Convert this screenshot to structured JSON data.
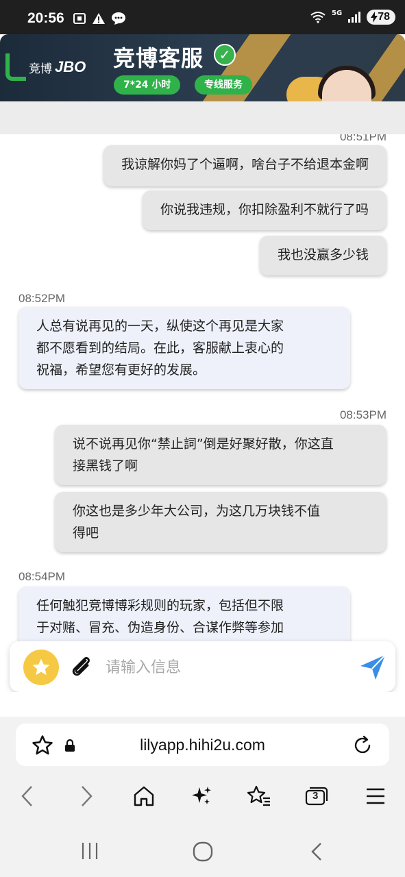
{
  "status_bar": {
    "time": "20:56",
    "battery": "78",
    "network": "5G"
  },
  "banner": {
    "logo_cn": "竞博",
    "logo_en": "JBO",
    "title": "竞博客服",
    "pill_hours": "7*24 小时",
    "pill_service": "专线服务",
    "accent_color": "#2fb24a"
  },
  "chat": {
    "partial_timestamp": "08:51PM",
    "messages": [
      {
        "side": "out",
        "text": "我谅解你妈了个逼啊，啥台子不给退本金啊"
      },
      {
        "side": "out",
        "text": "你说我违规，你扣除盈利不就行了吗"
      },
      {
        "side": "out",
        "text": "我也没赢多少钱"
      },
      {
        "side": "in",
        "timestamp": "08:52PM",
        "lines": [
          "人总有说再见的一天，纵使这个再见是大家",
          "都不愿看到的结局。在此，客服献上衷心的",
          "祝福，希望您有更好的发展。"
        ]
      },
      {
        "side": "out",
        "timestamp": "08:53PM",
        "lines": [
          "说不说再见你“禁止詞”倒是好聚好散，你这直",
          "接黑钱了啊"
        ]
      },
      {
        "side": "out",
        "lines": [
          "你这也是多少年大公司，为这几万块钱不值",
          "得吧"
        ]
      },
      {
        "side": "in",
        "timestamp": "08:54PM",
        "lines": [
          "任何触犯竞博博彩规则的玩家，包括但不限",
          "于对赌、冒充、伪造身份、合谋作弊等参加"
        ]
      }
    ]
  },
  "input": {
    "placeholder": "请输入信息",
    "emoji_icon": "star-icon",
    "attach_icon": "paperclip-icon",
    "send_icon": "send-icon"
  },
  "browser": {
    "url": "lilyapp.hihi2u.com",
    "tab_count": "3"
  }
}
